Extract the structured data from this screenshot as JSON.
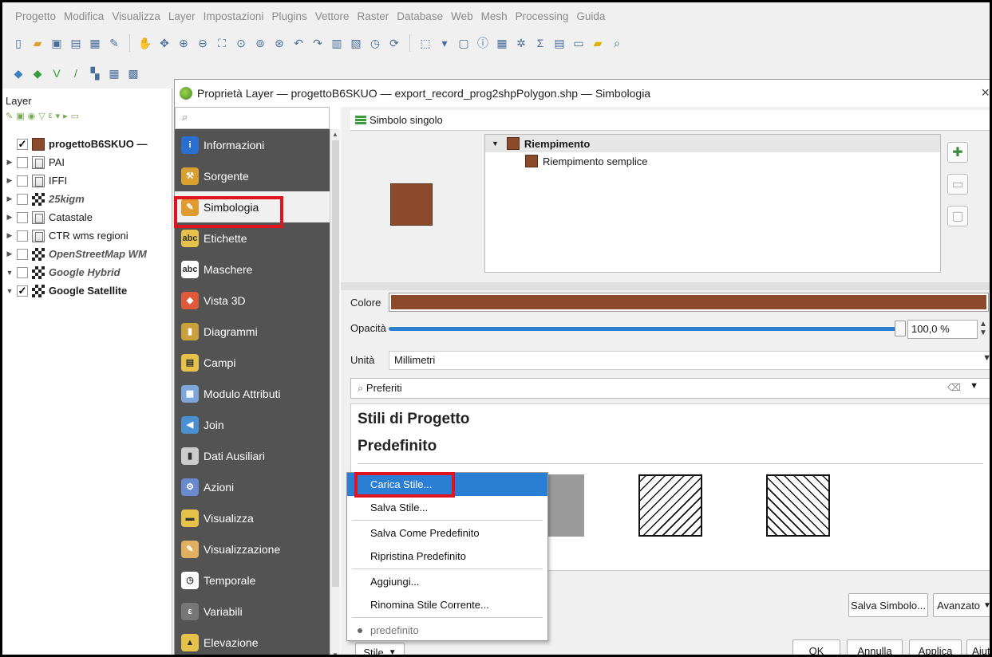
{
  "menubar": [
    "Progetto",
    "Modifica",
    "Visualizza",
    "Layer",
    "Impostazioni",
    "Plugins",
    "Vettore",
    "Raster",
    "Database",
    "Web",
    "Mesh",
    "Processing",
    "Guida"
  ],
  "layers_panel": {
    "title": "Layer",
    "layers": [
      {
        "name": "progettoB6SKUO —",
        "checked": true,
        "icon": "polygon-fill-icon",
        "style": "bold"
      },
      {
        "name": "PAI",
        "checked": false,
        "icon": "wms-layer-icon",
        "style": "normal"
      },
      {
        "name": "IFFI",
        "checked": false,
        "icon": "wms-layer-icon",
        "style": "normal"
      },
      {
        "name": "25kigm",
        "checked": false,
        "icon": "xyz-tile-icon",
        "style": "italic"
      },
      {
        "name": "Catastale",
        "checked": false,
        "icon": "wms-layer-icon",
        "style": "normal"
      },
      {
        "name": "CTR wms regioni",
        "checked": false,
        "icon": "wms-layer-icon",
        "style": "normal"
      },
      {
        "name": "OpenStreetMap WM",
        "checked": false,
        "icon": "xyz-tile-icon",
        "style": "italic"
      },
      {
        "name": "Google Hybrid",
        "checked": false,
        "icon": "xyz-tile-icon",
        "style": "italic"
      },
      {
        "name": "Google Satellite",
        "checked": true,
        "icon": "xyz-tile-icon",
        "style": "bold"
      }
    ]
  },
  "dialog": {
    "title": "Proprietà Layer — progettoB6SKUO — export_record_prog2shpPolygon.shp — Simbologia",
    "close": "×",
    "nav": [
      {
        "label": "Informazioni",
        "icon": "info-icon"
      },
      {
        "label": "Sorgente",
        "icon": "source-icon"
      },
      {
        "label": "Simbologia",
        "icon": "paintbrush-icon",
        "active": true
      },
      {
        "label": "Etichette",
        "icon": "labels-icon"
      },
      {
        "label": "Maschere",
        "icon": "masks-icon"
      },
      {
        "label": "Vista 3D",
        "icon": "cube-3d-icon"
      },
      {
        "label": "Diagrammi",
        "icon": "diagram-icon"
      },
      {
        "label": "Campi",
        "icon": "fields-icon"
      },
      {
        "label": "Modulo Attributi",
        "icon": "form-icon"
      },
      {
        "label": "Join",
        "icon": "join-icon"
      },
      {
        "label": "Dati Ausiliari",
        "icon": "database-icon"
      },
      {
        "label": "Azioni",
        "icon": "gear-icon"
      },
      {
        "label": "Visualizza",
        "icon": "speech-bubble-icon"
      },
      {
        "label": "Visualizzazione",
        "icon": "brush-icon"
      },
      {
        "label": "Temporale",
        "icon": "clock-icon"
      },
      {
        "label": "Variabili",
        "icon": "variable-icon"
      },
      {
        "label": "Elevazione",
        "icon": "elevation-icon"
      }
    ],
    "renderer": "Simbolo singolo",
    "symbol_tree": {
      "root": "Riempimento",
      "child": "Riempimento semplice"
    },
    "colore_label": "Colore",
    "opacita_label": "Opacità",
    "opacita_value": "100,0 %",
    "unita_label": "Unità",
    "unita_value": "Millimetri",
    "search_placeholder": "Preferiti",
    "style_groups": [
      "Stili di Progetto",
      "Predefinito"
    ],
    "buttons": {
      "salva_simbolo": "Salva Simbolo...",
      "avanzato": "Avanzato",
      "stile": "Stile",
      "ok": "OK",
      "annulla": "Annulla",
      "applica": "Applica",
      "aiuto": "Aiuto"
    },
    "context_menu": [
      {
        "label": "Carica Stile...",
        "highlighted": true
      },
      {
        "label": "Salva Stile..."
      },
      {
        "sep": true
      },
      {
        "label": "Salva Come Predefinito"
      },
      {
        "label": "Ripristina Predefinito"
      },
      {
        "sep": true
      },
      {
        "label": "Aggiungi..."
      },
      {
        "label": "Rinomina Stile Corrente..."
      },
      {
        "sep": true
      },
      {
        "label": "predefinito",
        "bullet": true
      }
    ]
  },
  "colors": {
    "fill": "#8b4a2a",
    "highlight_red": "#e0141e",
    "menu_selection": "#2a7fd5",
    "sidebar": "#535353"
  },
  "opacity_fraction": 1.0
}
